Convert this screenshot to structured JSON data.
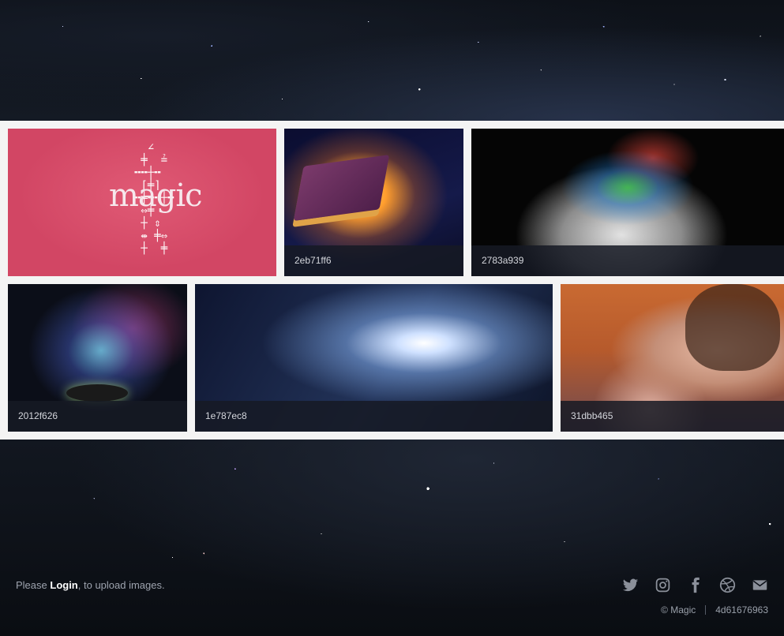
{
  "gallery": {
    "tiles": [
      {
        "id": "magic-logo",
        "caption": ""
      },
      {
        "id": "2eb71ff6",
        "caption": "2eb71ff6"
      },
      {
        "id": "2783a939",
        "caption": "2783a939"
      },
      {
        "id": "2012f626",
        "caption": "2012f626"
      },
      {
        "id": "1e787ec8",
        "caption": "1e787ec8"
      },
      {
        "id": "31dbb465",
        "caption": "31dbb465"
      }
    ],
    "logo_text": "magic"
  },
  "footer": {
    "login_prefix": "Please ",
    "login_link": "Login",
    "login_suffix": ", to upload images.",
    "social": [
      "twitter-icon",
      "instagram-icon",
      "facebook-icon",
      "dribbble-icon",
      "email-icon"
    ],
    "copyright": "© Magic",
    "hash": "4d61676963"
  },
  "colors": {
    "accent_tile": "#d24664",
    "caption_bg": "#161a24",
    "footer_text": "#9da3ae"
  }
}
